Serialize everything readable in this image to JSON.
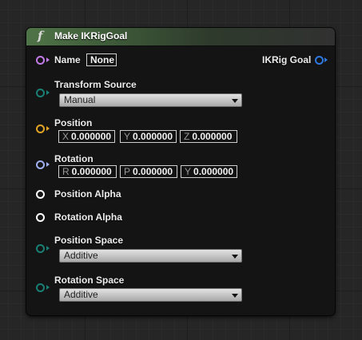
{
  "node": {
    "title": "Make IKRigGoal",
    "function_icon": "f",
    "header_color": "#4f7447"
  },
  "pins": {
    "name": {
      "label": "Name",
      "value": "None",
      "color": "#c27be8"
    },
    "output": {
      "label": "IKRig Goal",
      "color": "#2f78e0"
    },
    "transform_source": {
      "label": "Transform Source",
      "value": "Manual",
      "color": "#1a7f74"
    },
    "position": {
      "label": "Position",
      "color": "#e2a424",
      "x": {
        "axis": "X",
        "value": "0.000000"
      },
      "y": {
        "axis": "Y",
        "value": "0.000000"
      },
      "z": {
        "axis": "Z",
        "value": "0.000000"
      }
    },
    "rotation": {
      "label": "Rotation",
      "color": "#9fb0f2",
      "r": {
        "axis": "R",
        "value": "0.000000"
      },
      "p": {
        "axis": "P",
        "value": "0.000000"
      },
      "y": {
        "axis": "Y",
        "value": "0.000000"
      }
    },
    "position_alpha": {
      "label": "Position Alpha",
      "color": "#ffffff"
    },
    "rotation_alpha": {
      "label": "Rotation Alpha",
      "color": "#ffffff"
    },
    "position_space": {
      "label": "Position Space",
      "value": "Additive",
      "color": "#1a7f74"
    },
    "rotation_space": {
      "label": "Rotation Space",
      "value": "Additive",
      "color": "#1a7f74"
    }
  }
}
